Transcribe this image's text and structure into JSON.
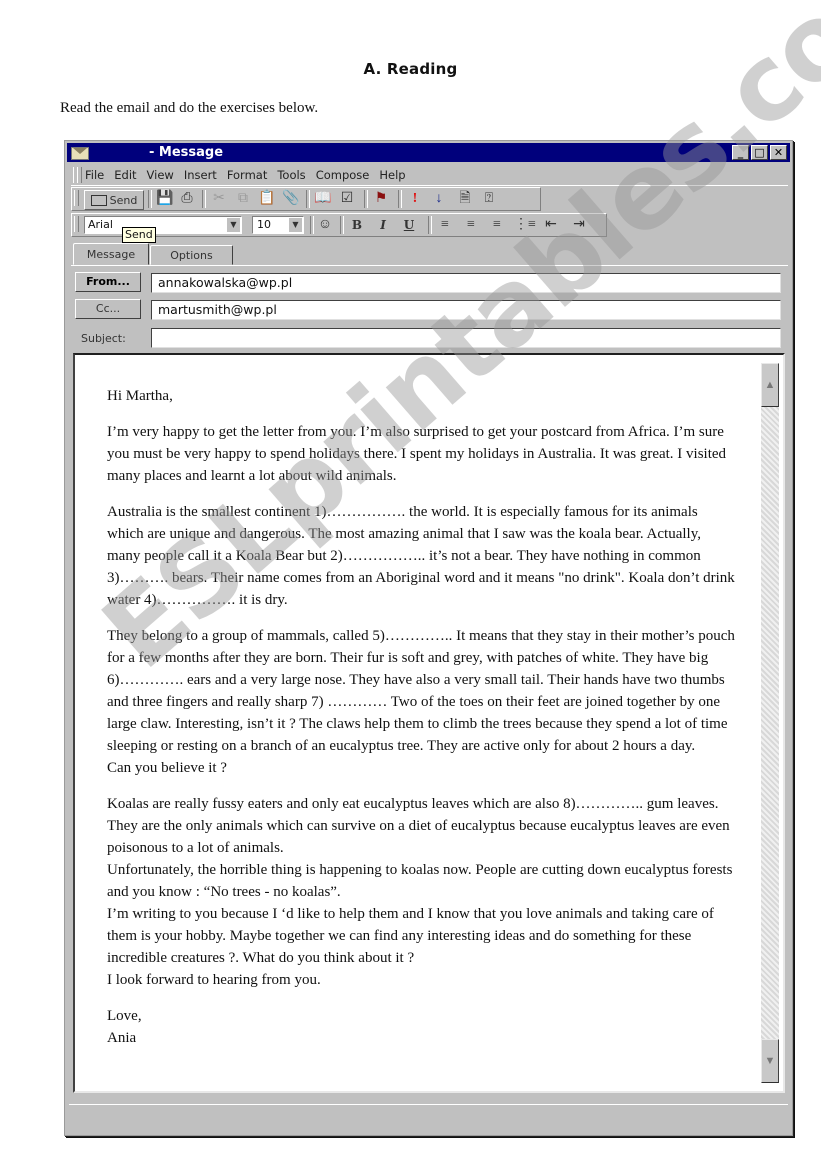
{
  "page": {
    "heading": "A. Reading",
    "instruction": "Read the email and do the exercises below.",
    "watermark": "ESLprintables.com"
  },
  "window": {
    "title": "- Message",
    "controls": {
      "minimize": "_",
      "maximize": "□",
      "close": "✕"
    }
  },
  "menu": {
    "items": [
      {
        "label": "File"
      },
      {
        "label": "Edit"
      },
      {
        "label": "View"
      },
      {
        "label": "Insert"
      },
      {
        "label": "Format"
      },
      {
        "label": "Tools"
      },
      {
        "label": "Compose"
      },
      {
        "label": "Help"
      }
    ]
  },
  "toolbar": {
    "send_label": "Send",
    "tooltip": "Send",
    "icons": [
      "save-icon",
      "print-icon",
      "cut-icon",
      "copy-icon",
      "paste-icon",
      "attach-icon",
      "address-book-icon",
      "check-names-icon",
      "flag-icon",
      "high-priority-icon",
      "low-priority-icon",
      "properties-icon",
      "help-icon"
    ]
  },
  "format_bar": {
    "font": "Arial",
    "size": "10",
    "bold": "B",
    "italic": "I",
    "underline": "U"
  },
  "tabs": [
    {
      "label": "Message",
      "active": true
    },
    {
      "label": "Options",
      "active": false
    }
  ],
  "header": {
    "from_label": "From...",
    "from_value": "annakowalska@wp.pl",
    "cc_label": "Cc...",
    "cc_value": "martusmith@wp.pl",
    "subject_label": "Subject:",
    "subject_value": ""
  },
  "email": {
    "greeting": "Hi Martha,",
    "paragraphs": [
      "I’m very happy to get the letter from you. I’m also surprised to get your postcard from Africa. I’m sure you must be very happy to spend holidays there. I spent my holidays in Australia. It was great. I visited many places and learnt a lot about wild animals.",
      "Australia is the smallest continent 1)……………. the world. It is especially famous for its animals which are unique and dangerous.  The most amazing animal that I saw was the koala bear. Actually, many people call it a Koala Bear but 2)…………….. it’s not a bear. They have nothing in common 3)……….    bears.  Their name comes from an Aboriginal word and it means \"no drink\". Koala don’t drink water 4)……………. it is dry.",
      " They belong to a group of  mammals, called 5)………….. It means that they stay in their mother’s pouch for a few months after they are born. Their fur  is soft and grey, with patches of white. They  have big 6)…………. ears and a very large nose. They have also a very small tail. Their hands have two thumbs and three fingers and really sharp 7) ………… Two of the toes on their feet are joined together by one large claw. Interesting, isn’t it ? The claws help them to climb the trees because they spend a lot of time sleeping or resting on a branch of an eucalyptus tree. They are active only for about 2 hours a day.",
      "Can you believe it ?",
      "Koalas are really fussy eaters and only eat eucalyptus leaves which are also 8)………….. gum leaves. They are the only animals which can survive on a diet of eucalyptus because eucalyptus leaves are even poisonous to a lot of animals.",
      "Unfortunately, the horrible thing is happening to koalas now. People are cutting down eucalyptus forests and  you know : “No trees - no koalas”.",
      "I’m writing to you because I ‘d like to help them and I know that you love animals and taking care of them is your hobby. Maybe together we can find any interesting ideas and do something for these incredible creatures ?. What do you think about it ?",
      "I look forward to hearing from you."
    ],
    "closing": "Love,",
    "signature": "Ania"
  }
}
